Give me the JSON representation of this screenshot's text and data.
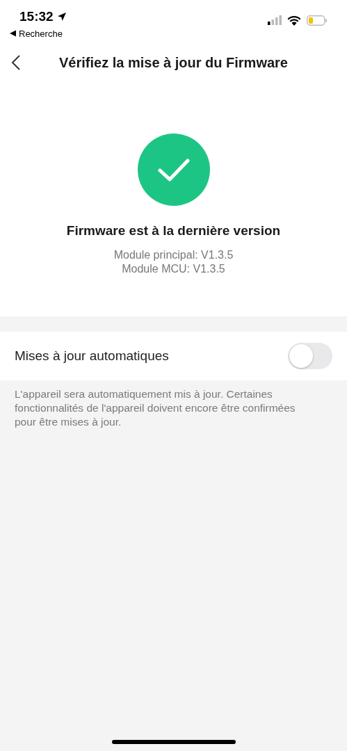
{
  "status_bar": {
    "time": "15:32",
    "back_app": "Recherche"
  },
  "nav": {
    "title": "Vérifiez la mise à jour du Firmware"
  },
  "status": {
    "title": "Firmware est à la dernière version",
    "lines": [
      "Module principal: V1.3.5",
      "Module MCU: V1.3.5"
    ]
  },
  "auto_update": {
    "label": "Mises à jour automatiques",
    "on": false,
    "description": "L'appareil sera automatiquement mis à jour. Certaines fonctionnalités de l'appareil doivent encore être confirmées pour être mises à jour."
  }
}
